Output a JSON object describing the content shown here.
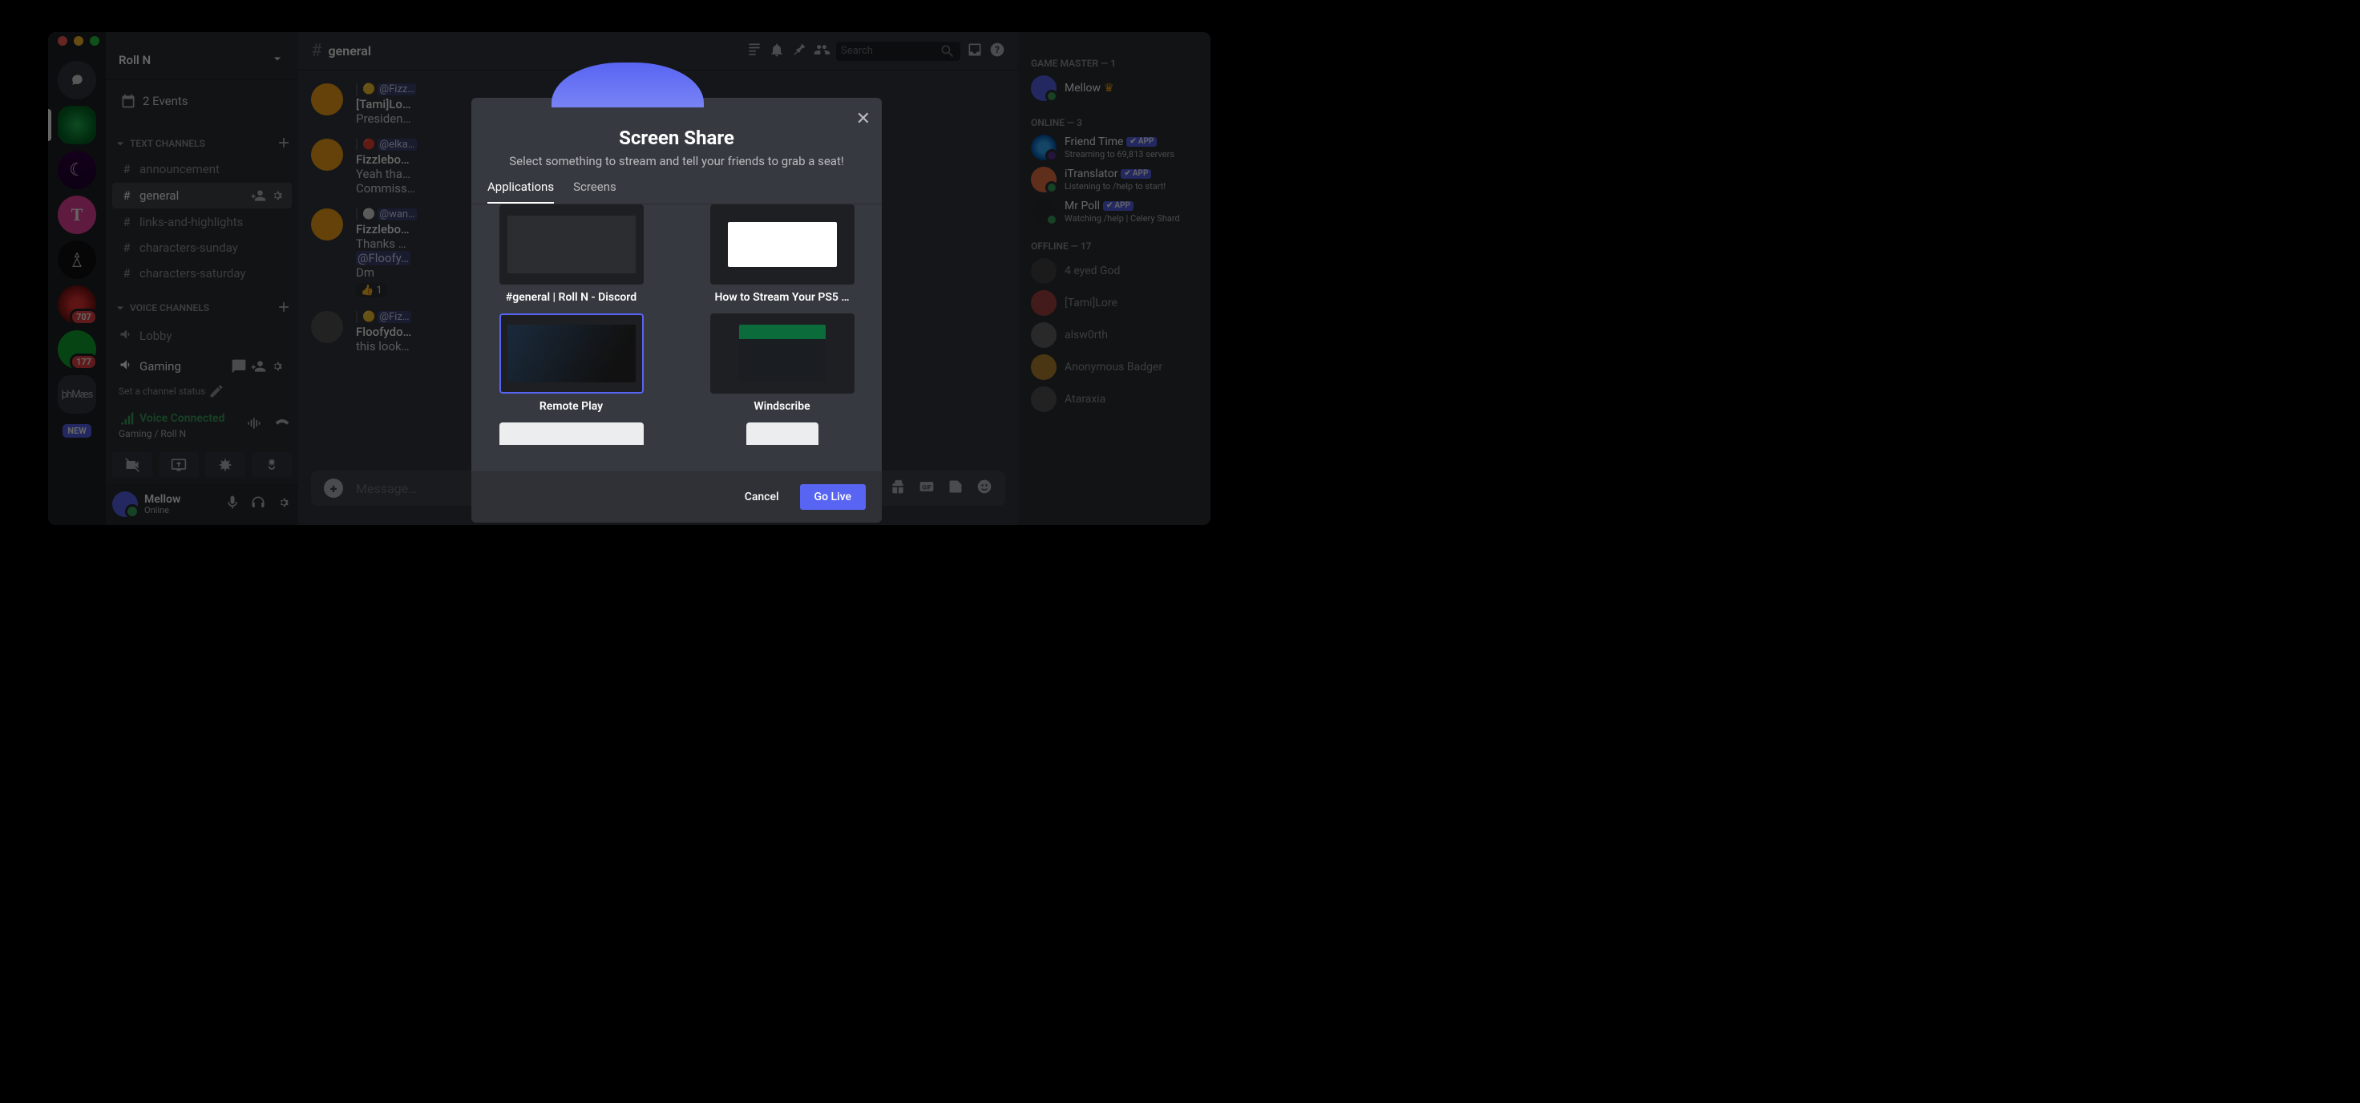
{
  "window": {
    "server_name": "Roll N"
  },
  "events_label": "2 Events",
  "categories": {
    "text": "TEXT CHANNELS",
    "voice": "VOICE CHANNELS"
  },
  "text_channels": [
    "announcement",
    "general",
    "links-and-highlights",
    "characters-sunday",
    "characters-saturday"
  ],
  "voice_channels": [
    "Lobby",
    "Gaming"
  ],
  "channel_status_hint": "Set a channel status",
  "voice_conn": {
    "status": "Voice Connected",
    "sub": "Gaming / Roll N"
  },
  "user": {
    "name": "Mellow",
    "status": "Online"
  },
  "topbar": {
    "channel": "general",
    "search_placeholder": "Search"
  },
  "server_badges": {
    "s5": "707",
    "s6": "177"
  },
  "new_label": "NEW",
  "messages": [
    {
      "avatar": "y",
      "mention": "@Fizz…",
      "preview_name": "[Tami]Lo…",
      "line2": "Presiden…"
    },
    {
      "avatar": "y",
      "mention": "@elka…",
      "name": "Fizzlebo…",
      "line2": "Yeah tha…",
      "line3": "Commiss…"
    },
    {
      "avatar": "y",
      "mention": "@wan…",
      "name": "Fizzlebo…",
      "line2": "Thanks …",
      "line3_mention": "@Floofy…",
      "line4": "Dm",
      "react": "👍 1"
    },
    {
      "avatar": "",
      "mention": "@Fiz…",
      "name": "Floofydo…",
      "line2": "this look…"
    }
  ],
  "message_placeholder": "Message…",
  "members": {
    "cat_gm": "GAME MASTER — 1",
    "gm": {
      "name": "Mellow",
      "crown": true
    },
    "cat_online": "ONLINE — 3",
    "online": [
      {
        "name": "Friend Time",
        "bot": "APP",
        "sub": "Streaming to 69,813 servers",
        "avatar": "globe"
      },
      {
        "name": "iTranslator",
        "bot": "APP",
        "sub": "Listening to /help to start!",
        "avatar": "trans"
      },
      {
        "name": "Mr Poll",
        "bot": "APP",
        "sub": "Watching /help | Celery Shard",
        "avatar": "poll"
      }
    ],
    "cat_offline": "OFFLINE — 17",
    "offline": [
      "4 eyed God",
      "[Tami]Lore",
      "alsw0rth",
      "Anonymous Badger",
      "Ataraxia"
    ]
  },
  "modal": {
    "title": "Screen Share",
    "subtitle": "Select something to stream and tell your friends to grab a seat!",
    "tabs": [
      "Applications",
      "Screens"
    ],
    "selected_tab": 0,
    "sources": [
      {
        "label": "#general | Roll N - Discord",
        "thumb": "dark"
      },
      {
        "label": "How to Stream Your PS5 …",
        "thumb": "light"
      },
      {
        "label": "Remote Play",
        "thumb": "dim2",
        "selected": true
      },
      {
        "label": "Windscribe",
        "thumb": "wind"
      }
    ],
    "cancel": "Cancel",
    "go": "Go Live"
  }
}
